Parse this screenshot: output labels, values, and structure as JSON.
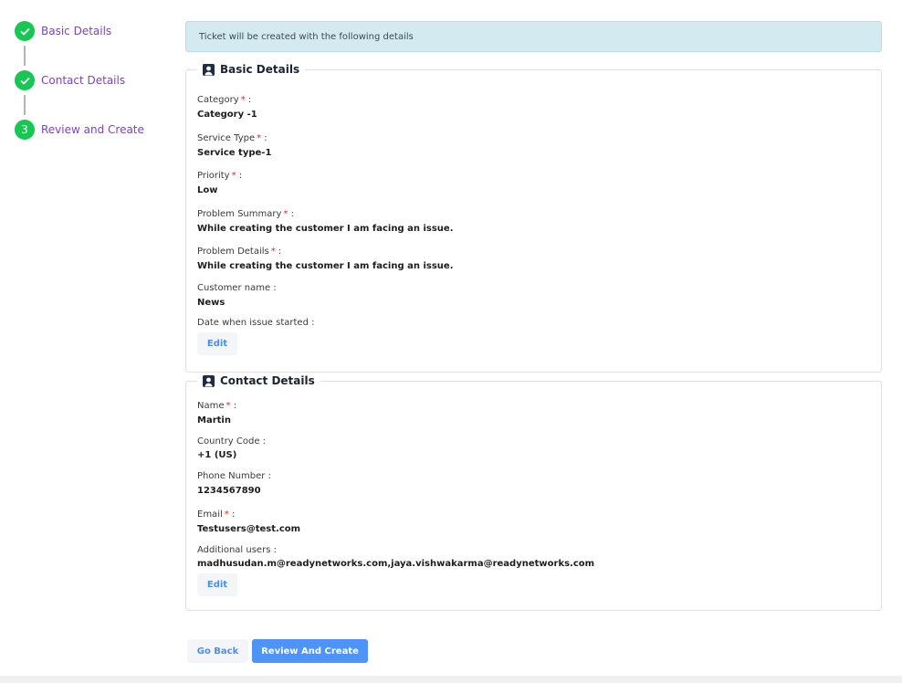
{
  "stepper": {
    "steps": [
      {
        "label": "Basic Details",
        "state": "done",
        "marker": ""
      },
      {
        "label": "Contact Details",
        "state": "done",
        "marker": ""
      },
      {
        "label": "Review and Create",
        "state": "current",
        "marker": "3"
      }
    ]
  },
  "alert": {
    "text": "Ticket will be created with the following details"
  },
  "basic": {
    "title": "Basic Details",
    "fields": [
      {
        "label": "Category",
        "value": "Category -1"
      },
      {
        "label": "Service Type",
        "value": "Service type-1"
      },
      {
        "label": "Priority",
        "value": "Low"
      },
      {
        "label": "Problem Summary",
        "value": "While creating the customer I am facing an issue."
      },
      {
        "label": "Problem Details",
        "value": "While creating the customer I am facing an issue."
      },
      {
        "label": "Customer name :",
        "value": "News"
      },
      {
        "label": "Date when issue started :",
        "value": ""
      }
    ],
    "edit_label": "Edit"
  },
  "contact": {
    "title": "Contact Details",
    "fields": [
      {
        "label": "Name",
        "value": "Martin"
      },
      {
        "label": "Country Code :",
        "value": "+1 (US)"
      },
      {
        "label": "Phone Number :",
        "value": "1234567890"
      },
      {
        "label": "Email",
        "value": "Testusers@test.com"
      },
      {
        "label": "Additional users :",
        "value": "madhusudan.m@readynetworks.com,jaya.vishwakarma@readynetworks.com"
      }
    ],
    "edit_label": "Edit"
  },
  "required_mark": "*",
  "required_suffix": ":",
  "actions": {
    "back_label": "Go Back",
    "create_label": "Review And Create"
  },
  "colors": {
    "accent": "#4e94f8",
    "step_done": "#17c653",
    "step_label": "#7e3fd0",
    "alert_bg": "#d3eaf0",
    "required": "#e4262c"
  }
}
